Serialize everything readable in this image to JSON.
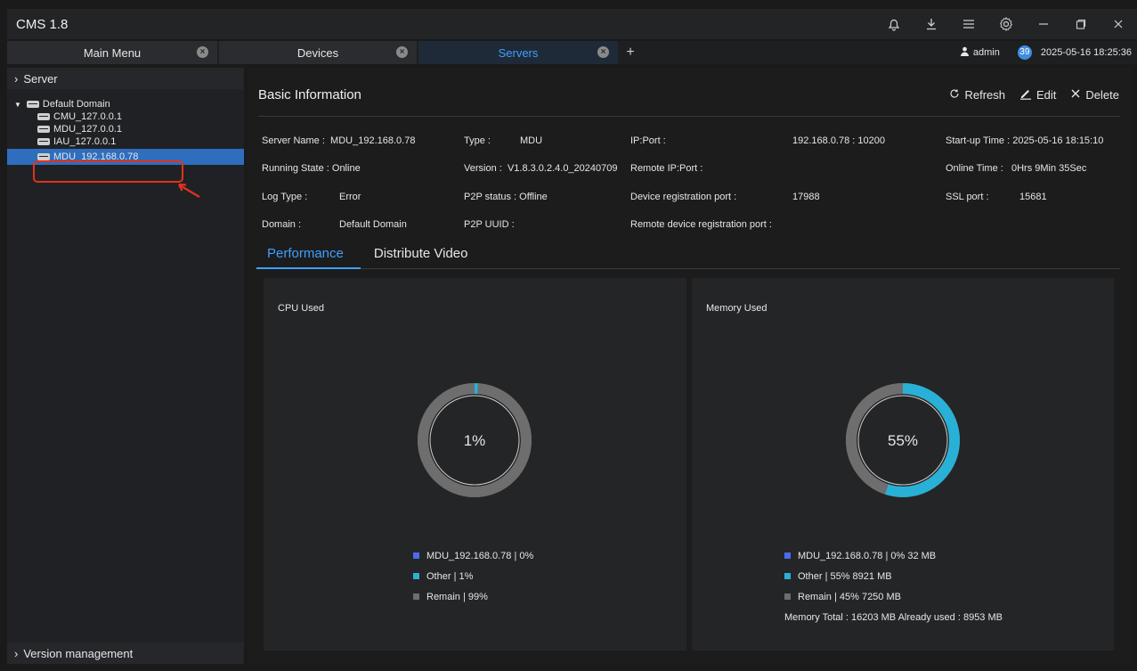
{
  "app": {
    "title": "CMS 1.8"
  },
  "titlebar_icons": [
    "bell-icon",
    "download-icon",
    "menu-icon",
    "settings-icon",
    "minimize-icon",
    "restore-icon",
    "close-icon"
  ],
  "tabs": [
    {
      "label": "Main Menu",
      "active": false
    },
    {
      "label": "Devices",
      "active": false
    },
    {
      "label": "Servers",
      "active": true
    }
  ],
  "user": {
    "name": "admin",
    "badge": "39",
    "datetime": "2025-05-16 18:25:36"
  },
  "sidebar": {
    "header": "Server",
    "domain": "Default Domain",
    "items": [
      "CMU_127.0.0.1",
      "MDU_127.0.0.1",
      "IAU_127.0.0.1",
      "MDU_192.168.0.78"
    ],
    "selected_index": 3,
    "footer": "Version management"
  },
  "basic_info": {
    "title": "Basic Information",
    "actions": {
      "refresh": "Refresh",
      "edit": "Edit",
      "delete": "Delete"
    },
    "col1": [
      {
        "label": "Server Name :",
        "value": "MDU_192.168.0.78"
      },
      {
        "label": "Running State : Online",
        "value": ""
      },
      {
        "label": "Log Type :",
        "value": "Error"
      },
      {
        "label": "Domain :",
        "value": "Default Domain"
      }
    ],
    "col2": [
      {
        "label": "Type :",
        "value": "MDU"
      },
      {
        "label": "Version :",
        "value": "V1.8.3.0.2.4.0_20240709"
      },
      {
        "label": "P2P status : Offline",
        "value": ""
      },
      {
        "label": "P2P UUID :",
        "value": ""
      }
    ],
    "col3": [
      {
        "label": "IP:Port :",
        "value": "192.168.0.78 : 10200"
      },
      {
        "label": "Remote IP:Port :",
        "value": ""
      },
      {
        "label": "Device registration port :",
        "value": "17988"
      },
      {
        "label": "Remote device registration port :",
        "value": ""
      }
    ],
    "col4": [
      {
        "label": "Start-up Time :",
        "value": "2025-05-16 18:15:10"
      },
      {
        "label": "Online Time :",
        "value": "0Hrs 9Min 35Sec"
      },
      {
        "label": "SSL port :",
        "value": "15681"
      }
    ]
  },
  "sub_tabs": [
    {
      "label": "Performance",
      "active": true
    },
    {
      "label": "Distribute Video",
      "active": false
    }
  ],
  "colors": {
    "accent": "#3fa0ff",
    "mdu": "#4a6cf0",
    "other": "#29b0d6",
    "remain": "#6e6e6e",
    "selected": "#2f6dbd"
  },
  "cpu": {
    "title": "CPU Used",
    "center": "1%",
    "segments": [
      {
        "label": "MDU_192.168.0.78 | 0%",
        "fraction": 0.0,
        "color": "#4a6cf0"
      },
      {
        "label": "Other | 1%",
        "fraction": 0.01,
        "color": "#29b0d6"
      },
      {
        "label": "Remain | 99%",
        "fraction": 0.99,
        "color": "#6e6e6e"
      }
    ]
  },
  "memory": {
    "title": "Memory Used",
    "center": "55%",
    "segments": [
      {
        "label": "MDU_192.168.0.78 | 0% 32 MB",
        "fraction": 0.0,
        "color": "#4a6cf0"
      },
      {
        "label": "Other | 55% 8921 MB",
        "fraction": 0.55,
        "color": "#29b0d6"
      },
      {
        "label": "Remain | 45% 7250 MB",
        "fraction": 0.45,
        "color": "#6e6e6e"
      }
    ],
    "total_text": "Memory Total : 16203 MB  Already used : 8953 MB"
  }
}
